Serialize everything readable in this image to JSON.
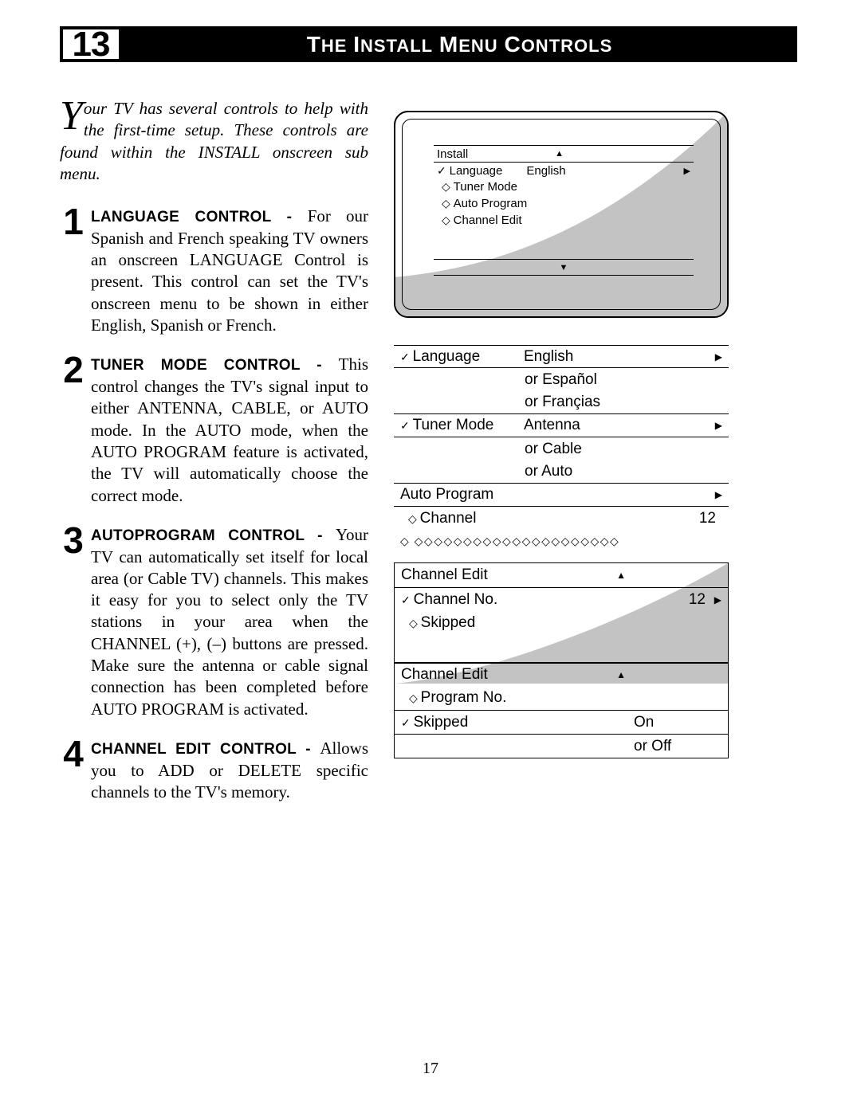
{
  "header": {
    "number": "13",
    "title_caps": [
      "T",
      " I",
      " M",
      " C"
    ],
    "title_small": [
      "HE",
      "NSTALL",
      "ENU",
      "ONTROLS"
    ],
    "full_title": "THE INSTALL MENU CONTROLS"
  },
  "intro": {
    "dropcap": "Y",
    "text": "our TV has several controls to help with the first-time setup. These controls are found within the INSTALL onscreen sub menu."
  },
  "steps": [
    {
      "num": "1",
      "title": "LANGUAGE CONTROL - ",
      "body": "For our Spanish and French speaking TV owners an onscreen LANGUAGE Control is present. This control can set the TV's onscreen menu to be shown in either English, Spanish or French."
    },
    {
      "num": "2",
      "title": "TUNER MODE CONTROL - ",
      "body": "This control changes the TV's signal input to either ANTENNA, CABLE, or AUTO mode. In the AUTO mode, when the AUTO PROGRAM feature is activated, the TV will automatically choose the correct mode."
    },
    {
      "num": "3",
      "title": "AUTOPROGRAM CONTROL - ",
      "body": "Your TV can automatically set itself for local area (or Cable TV) channels. This makes it easy for you to select only the TV stations in your area when the CHANNEL (+), (–) buttons are pressed. Make sure the antenna or cable signal connection has been completed before AUTO PROGRAM is activated."
    },
    {
      "num": "4",
      "title": "CHANNEL EDIT CONTROL - ",
      "body": "Allows you to ADD or DELETE specific channels to the TV's memory."
    }
  ],
  "tvmenu": {
    "top": "Install",
    "rows": [
      {
        "icon": "chk",
        "label": "Language",
        "value": "English",
        "arrow": true
      },
      {
        "icon": "dia",
        "label": "Tuner Mode"
      },
      {
        "icon": "dia",
        "label": "Auto Program"
      },
      {
        "icon": "dia",
        "label": "Channel Edit"
      }
    ]
  },
  "detail": {
    "language": {
      "label": "Language",
      "value": "English",
      "alts": [
        "or Español",
        "or Françias"
      ]
    },
    "tuner": {
      "label": "Tuner Mode",
      "value": "Antenna",
      "alts": [
        "or Cable",
        "or Auto"
      ]
    },
    "autoprog": {
      "label": "Auto Program"
    },
    "channel": {
      "label": "Channel",
      "value": "12"
    },
    "diamonds": "◇   ◇◇◇◇◇◇◇◇◇◇◇◇◇◇◇◇◇◇◇◇◇"
  },
  "chedit1": {
    "title": "Channel Edit",
    "rows": [
      {
        "icon": "chk",
        "label": "Channel No.",
        "value": "12",
        "arrow": true
      },
      {
        "icon": "dia",
        "label": "Skipped"
      }
    ]
  },
  "chedit2": {
    "title": "Channel Edit",
    "rows": [
      {
        "icon": "dia",
        "label": "Program No."
      },
      {
        "icon": "chk",
        "label": "Skipped",
        "value": "On"
      }
    ],
    "alt": "or Off"
  },
  "page": "17"
}
